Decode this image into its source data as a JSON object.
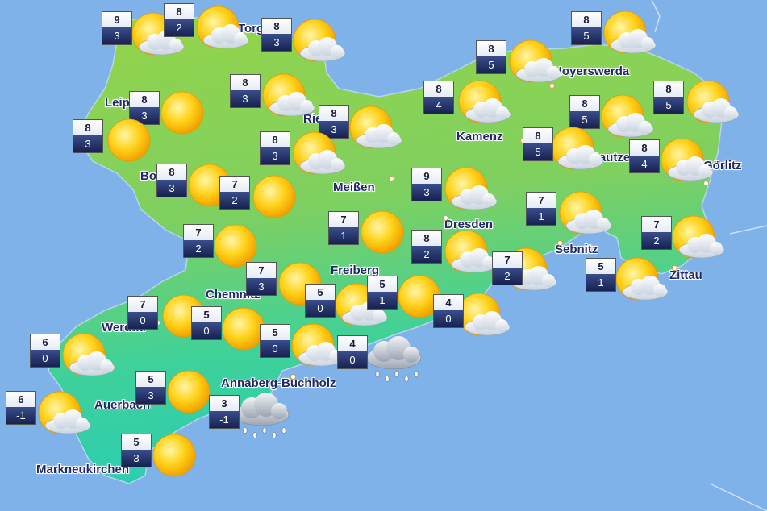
{
  "colors": {
    "water": "#7fb2e8",
    "land_north": "#8fd24b",
    "land_south": "#2fd0a8",
    "label_text": "#1f2a66",
    "box_max_bg": "#ffffff",
    "box_min_bg": "#16224f"
  },
  "stations": [
    {
      "max": "9",
      "min": "3",
      "symbol": "sun-cloud-icon"
    },
    {
      "max": "8",
      "min": "2",
      "symbol": "sun-cloud-icon"
    },
    {
      "max": "8",
      "min": "3",
      "symbol": "sun-cloud-icon"
    },
    {
      "max": "8",
      "min": "5",
      "symbol": "sun-cloud-icon"
    },
    {
      "max": "8",
      "min": "5",
      "symbol": "sun-cloud-icon"
    },
    {
      "max": "8",
      "min": "4",
      "symbol": "sun-cloud-icon"
    },
    {
      "max": "8",
      "min": "3",
      "symbol": "sun-cloud-icon"
    },
    {
      "max": "8",
      "min": "3",
      "symbol": "sun-icon"
    },
    {
      "max": "8",
      "min": "3",
      "symbol": "sun-icon"
    },
    {
      "max": "8",
      "min": "3",
      "symbol": "sun-cloud-icon"
    },
    {
      "max": "8",
      "min": "3",
      "symbol": "sun-cloud-icon"
    },
    {
      "max": "8",
      "min": "5",
      "symbol": "sun-cloud-icon"
    },
    {
      "max": "8",
      "min": "5",
      "symbol": "sun-cloud-icon"
    },
    {
      "max": "8",
      "min": "5",
      "symbol": "sun-cloud-icon"
    },
    {
      "max": "8",
      "min": "4",
      "symbol": "sun-cloud-icon"
    },
    {
      "max": "8",
      "min": "3",
      "symbol": "sun-icon"
    },
    {
      "max": "7",
      "min": "2",
      "symbol": "sun-icon"
    },
    {
      "max": "9",
      "min": "3",
      "symbol": "sun-cloud-icon"
    },
    {
      "max": "7",
      "min": "1",
      "symbol": "sun-cloud-icon"
    },
    {
      "max": "7",
      "min": "2",
      "symbol": "sun-cloud-icon"
    },
    {
      "max": "7",
      "min": "2",
      "symbol": "sun-icon"
    },
    {
      "max": "7",
      "min": "1",
      "symbol": "sun-icon"
    },
    {
      "max": "8",
      "min": "2",
      "symbol": "sun-cloud-icon"
    },
    {
      "max": "7",
      "min": "2",
      "symbol": "sun-cloud-icon"
    },
    {
      "max": "5",
      "min": "1",
      "symbol": "sun-cloud-icon"
    },
    {
      "max": "7",
      "min": "3",
      "symbol": "sun-icon"
    },
    {
      "max": "5",
      "min": "0",
      "symbol": "sun-cloud-icon"
    },
    {
      "max": "5",
      "min": "1",
      "symbol": "sun-icon"
    },
    {
      "max": "4",
      "min": "0",
      "symbol": "sun-cloud-icon"
    },
    {
      "max": "7",
      "min": "0",
      "symbol": "sun-icon"
    },
    {
      "max": "5",
      "min": "0",
      "symbol": "sun-icon"
    },
    {
      "max": "5",
      "min": "0",
      "symbol": "sun-cloud-icon"
    },
    {
      "max": "4",
      "min": "0",
      "symbol": "rain-cloud-icon"
    },
    {
      "max": "6",
      "min": "0",
      "symbol": "sun-cloud-icon"
    },
    {
      "max": "5",
      "min": "3",
      "symbol": "sun-icon"
    },
    {
      "max": "6",
      "min": "-1",
      "symbol": "sun-cloud-icon"
    },
    {
      "max": "3",
      "min": "-1",
      "symbol": "rain-cloud-icon"
    },
    {
      "max": "5",
      "min": "3",
      "symbol": "sun-icon"
    }
  ],
  "cities": [
    {
      "name": "Torgau"
    },
    {
      "name": "Hoyerswerda"
    },
    {
      "name": "Leipzig"
    },
    {
      "name": "Riesa"
    },
    {
      "name": "Kamenz"
    },
    {
      "name": "Bautzen"
    },
    {
      "name": "Görlitz"
    },
    {
      "name": "Borna"
    },
    {
      "name": "Meißen"
    },
    {
      "name": "Dresden"
    },
    {
      "name": "Sebnitz"
    },
    {
      "name": "Zittau"
    },
    {
      "name": "Freiberg"
    },
    {
      "name": "Chemnitz"
    },
    {
      "name": "Werdau"
    },
    {
      "name": "Annaberg-Buchholz"
    },
    {
      "name": "Auerbach"
    },
    {
      "name": "Markneukirchen"
    }
  ]
}
